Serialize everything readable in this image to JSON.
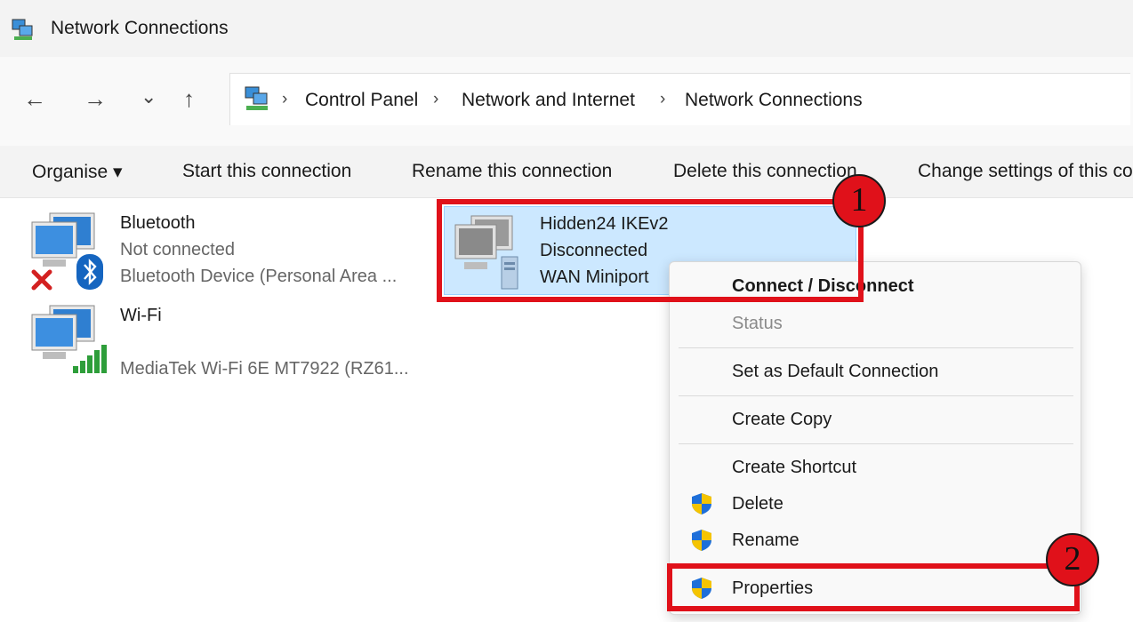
{
  "window": {
    "title": "Network Connections"
  },
  "nav": {
    "back": "←",
    "forward": "→",
    "recent": "⌄",
    "up": "↑"
  },
  "breadcrumb": {
    "separator": "›",
    "items": [
      "Control Panel",
      "Network and Internet",
      "Network Connections"
    ]
  },
  "toolbar": {
    "organise": "Organise ▾",
    "start": "Start this connection",
    "rename": "Rename this connection",
    "delete": "Delete this connection",
    "change": "Change settings of this connection"
  },
  "connections": [
    {
      "name": "Bluetooth",
      "status": "Not connected",
      "device": "Bluetooth Device (Personal Area ..."
    },
    {
      "name": "Wi-Fi",
      "status": "",
      "device": "MediaTek Wi-Fi 6E MT7922 (RZ61..."
    },
    {
      "name": "Hidden24 IKEv2",
      "status": "Disconnected",
      "device": "WAN Miniport"
    }
  ],
  "context_menu": {
    "items": [
      "Connect / Disconnect",
      "Status",
      "Set as Default Connection",
      "Create Copy",
      "Create Shortcut",
      "Delete",
      "Rename",
      "Properties"
    ]
  },
  "annotations": {
    "step1": "1",
    "step2": "2"
  },
  "colors": {
    "annotation_red": "#e0111a",
    "selection": "#cce8ff",
    "shield_blue": "#1e6fd9",
    "shield_yellow": "#f5c400"
  }
}
